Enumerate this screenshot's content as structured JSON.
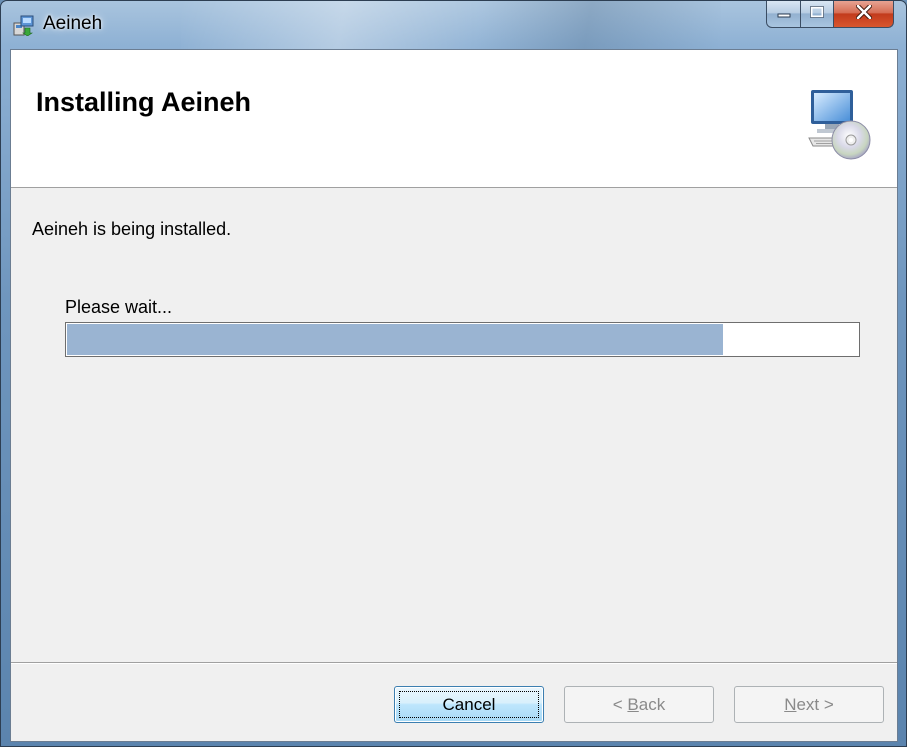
{
  "window": {
    "title": "Aeineh"
  },
  "caption_buttons": {
    "minimize_icon": "minimize-icon",
    "maximize_icon": "maximize-icon",
    "close_icon": "close-icon",
    "close_color": "#c9421f"
  },
  "banner": {
    "title": "Installing Aeineh",
    "art_icon": "computer-cd-icon"
  },
  "main": {
    "status_text": "Aeineh is being installed.",
    "wait_label": "Please wait...",
    "progress_fraction": 0.83,
    "progress_color": "#9ab4d2"
  },
  "buttons": {
    "cancel": "Cancel",
    "back_prefix": "< ",
    "back_mnemonic": "B",
    "back_rest": "ack",
    "next_mnemonic": "N",
    "next_rest": "ext >"
  }
}
